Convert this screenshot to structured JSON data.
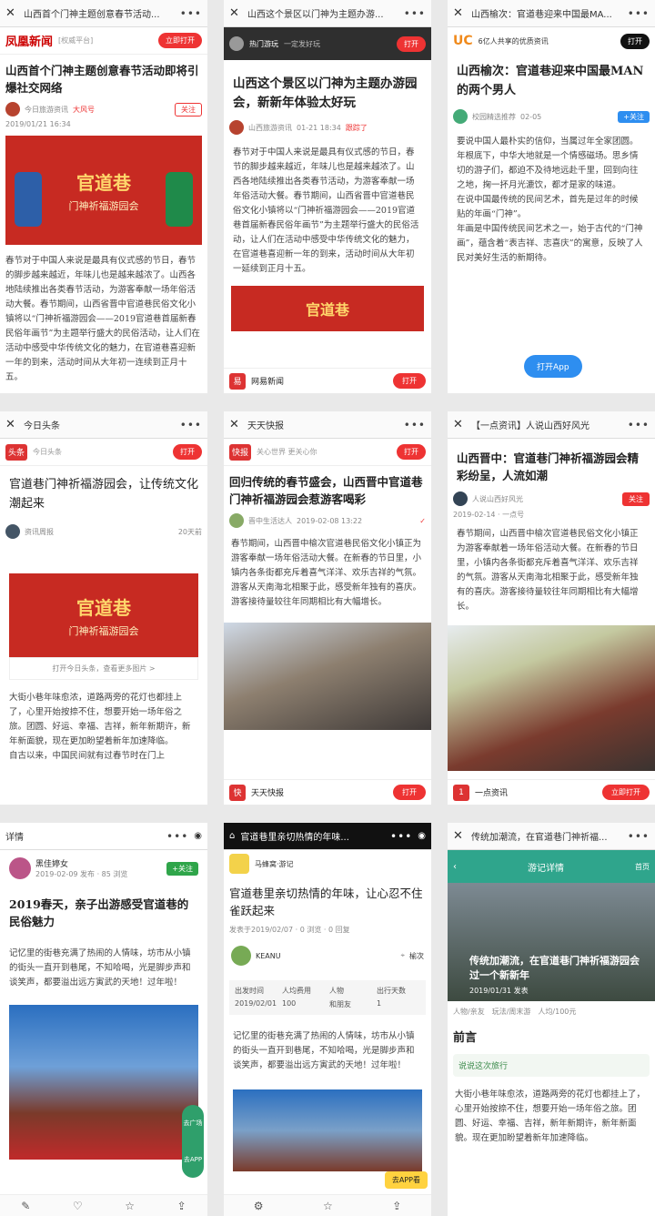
{
  "cells": [
    {
      "topbar": "山西首个门神主题创意春节活动...",
      "brand": "凤凰新闻",
      "brand_sub": "[权威平台]",
      "open": "立即打开",
      "title": "山西首个门神主题创意春节活动即将引爆社交网络",
      "author": "今日旅游资讯",
      "badge": "大风号",
      "date": "2019/01/21 16:34",
      "follow": "关注",
      "banner_title": "官道巷",
      "banner_sub": "门神祈福游园会",
      "body": "春节对于中国人来说是最具有仪式感的节日，春节的脚步越来越近，年味儿也是越来越浓了。山西各地陆续推出各类春节活动，为游客奉献一场年俗活动大餐。春节期间，山西省晋中官道巷民俗文化小镇将以“门神祈福游园会——2019官道巷首届新春民俗年画节”为主题举行盛大的民俗活动，让人们在活动中感受中华传统文化的魅力，在官道巷喜迎新一年的到来，活动时间从大年初一连续到正月十五。"
    },
    {
      "topbar": "山西这个景区以门神为主题办游...",
      "hot": "热门游玩",
      "hot_sub": "一定发好玩",
      "open": "打开",
      "title": "山西这个景区以门神为主题办游园会，新新年体验太好玩",
      "author": "山西旅游资讯",
      "date": "01-21 18:34",
      "follow": "跟踪了",
      "body": "春节对于中国人来说是最具有仪式感的节日，春节的脚步越来越近，年味儿也是越来越浓了。山西各地陆续推出各类春节活动，为游客奉献一场年俗活动大餐。春节期间，山西省晋中官道巷民俗文化小镇将以“门神祈福游园会——2019官道巷首届新春民俗年画节”为主题举行盛大的民俗活动，让人们在活动中感受中华传统文化的魅力，在官道巷喜迎新一年的到来，活动时间从大年初一延续到正月十五。",
      "banner_title": "官道巷",
      "foot": "网易新闻",
      "foot_btn": "打开"
    },
    {
      "topbar": "山西榆次：官道巷迎来中国最MA...",
      "brand": "UC",
      "brand_sub": "6亿人共享的优质资讯",
      "open": "打开",
      "title": "山西榆次：官道巷迎来中国最MAN的两个男人",
      "author": "校园精选推荐",
      "date": "02-05",
      "follow": "+关注",
      "body": "要说中国人最朴实的信仰，当属过年全家团圆。\n年根底下，中华大地就是一个情感磁场。思乡情切的游子们，都迫不及待地远赴千里，回到向往之地，掬一抔月光漉饮，都才是家的味道。\n在说中国最传统的民间艺术，首先是过年的时候贴的年画“门神”。\n年画是中国传统民间艺术之一，始于古代的“门神画”，蕴含着“表吉祥、志喜庆”的寓意，反映了人民对美好生活的新期待。",
      "float": "打开App"
    },
    {
      "topbar": "今日头条",
      "brand": "头条",
      "brand_sub": "今日头条",
      "open": "打开",
      "title": "官道巷门神祈福游园会，让传统文化潮起来",
      "author": "资讯周报",
      "date": "20天前",
      "banner_title": "官道巷",
      "banner_sub": "门神祈福游园会",
      "more": "打开今日头条，查看更多图片 >",
      "body": "大街小巷年味愈浓，道路两旁的花灯也都挂上了，心里开始按捺不住，想要开始一场年俗之旅。团圆、好运、幸福、吉祥，新年新期许，新年新面貌，现在更加盼望着新年加速降临。\n自古以来，中国民间就有过春节时在门上"
    },
    {
      "topbar": "天天快报",
      "brand": "快报",
      "brand_sub": "关心世界 更关心你",
      "open": "打开",
      "title": "回归传统的春节盛会，山西晋中官道巷门神祈福游园会惹游客喝彩",
      "author": "晋中生活达人",
      "date": "2019-02-08 13:22",
      "body": "春节期间，山西晋中榆次官道巷民俗文化小镇正为游客奉献一场年俗活动大餐。在新春的节日里，小镇内各条街都充斥着喜气洋洋、欢乐吉祥的气氛。游客从天南海北相聚于此，感受新年独有的喜庆。游客接待量较往年同期相比有大幅增长。",
      "foot": "天天快报",
      "foot_btn": "打开"
    },
    {
      "topbar": "【一点资讯】人说山西好风光",
      "title": "山西晋中：官道巷门神祈福游园会精彩纷呈，人流如潮",
      "author": "人说山西好风光",
      "date": "2019-02-14 · 一点号",
      "follow": "关注",
      "body": "春节期间，山西晋中榆次官道巷民俗文化小镇正为游客奉献着一场年俗活动大餐。在新春的节日里，小镇内各条街都充斥着喜气洋洋、欢乐吉祥的气氛。游客从天南海北相聚于此，感受新年独有的喜庆。游客接待量较往年同期相比有大幅增长。",
      "foot": "一点资讯",
      "foot_btn": "立即打开"
    },
    {
      "topbar": "详情",
      "author": "黑佳婷女",
      "date": "2019-02-09 发布 · 85 浏览",
      "follow": "+关注",
      "title": "2019春天，亲子出游感受官道巷的民俗魅力",
      "body": "记忆里的街巷充满了热闹的人情味，坊市从小镇的街头一直开到巷尾，不知哈喝，光是脚步声和谈笑声，都要溢出远方寅武的天地！过年啦！",
      "side1": "去广场",
      "side2": "去APP"
    },
    {
      "topbar": "官道巷里亲切热情的年味...",
      "brand": "马蜂窝·游记",
      "title": "官道巷里亲切热情的年味，让心忍不住雀跃起来",
      "date": "发表于2019/02/07 · 0 浏览 · 0 回复",
      "author": "KEANU",
      "location": "榆次",
      "table_headers": [
        "出发时间",
        "人均费用",
        "人物",
        "出行天数"
      ],
      "table_values": [
        "2019/02/01",
        "100",
        "和朋友",
        "1"
      ],
      "body": "记忆里的街巷充满了热闹的人情味，坊市从小镇的街头一直开到巷尾，不知哈喝，光是脚步声和谈笑声，都要溢出远方寅武的天地！过年啦！",
      "app": "去APP看"
    },
    {
      "topbar": "传统加潮流，在官道巷门神祈福...",
      "bar_title": "游记详情",
      "bar_right": "首页",
      "hero_text": "传统加潮流，在官道巷门神祈福游园会过一个新新年",
      "hero_date": "2019/01/31 发表",
      "tags": [
        "人物/亲友",
        "玩法/周末游",
        "人均/100元"
      ],
      "section": "前言",
      "chip": "说说这次旅行",
      "body": "大街小巷年味愈浓，道路两旁的花灯也都挂上了，心里开始按捺不住，想要开始一场年俗之旅。团圆、好运、幸福、吉祥，新年新期许，新年新面貌。现在更加盼望着新年加速降临。"
    }
  ]
}
